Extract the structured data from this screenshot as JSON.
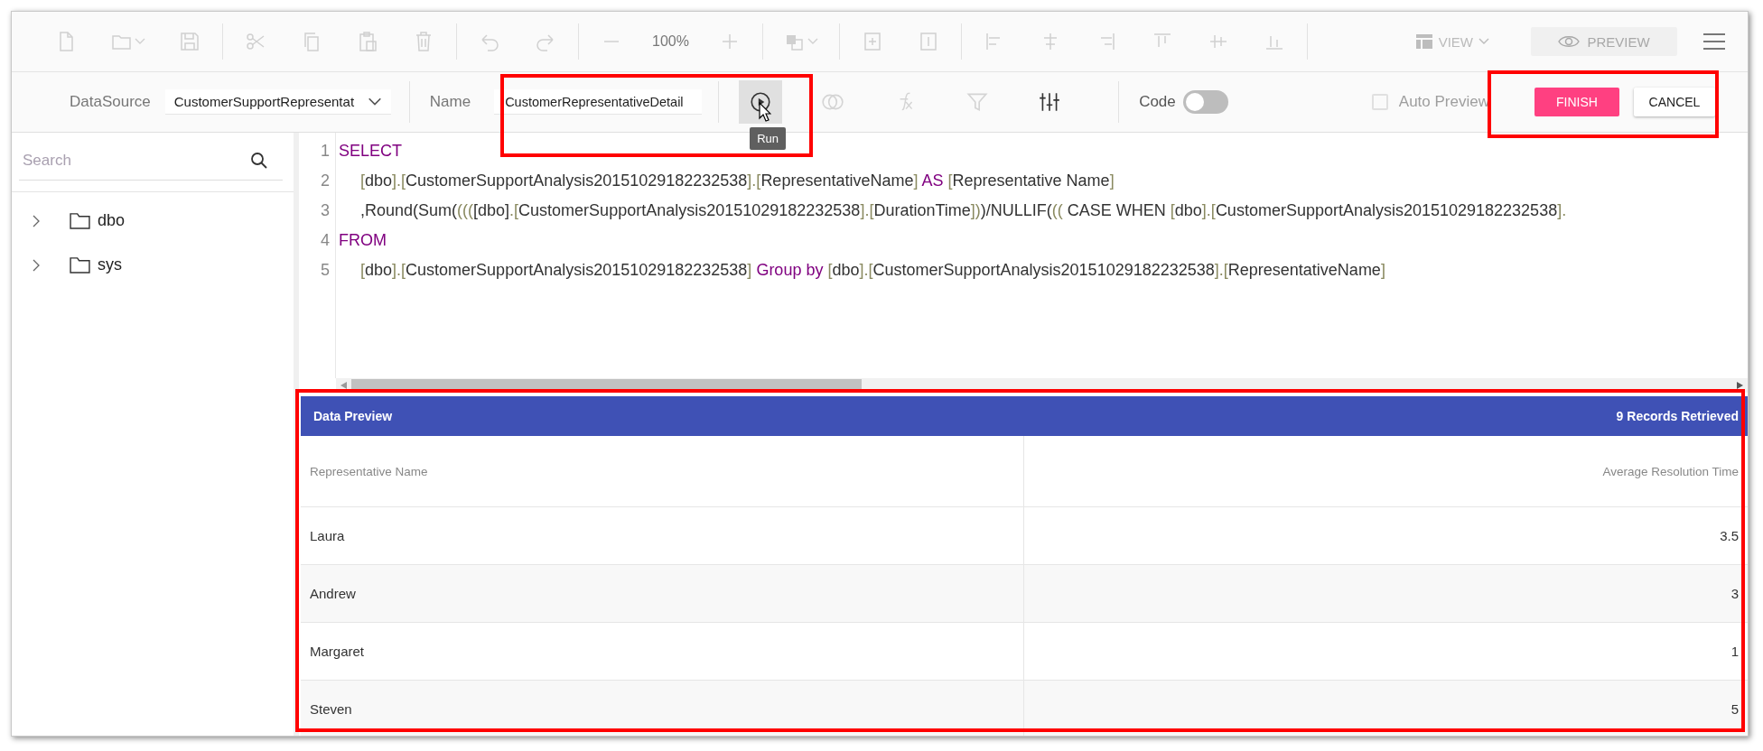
{
  "toolbar": {
    "items": [
      {
        "kind": "new",
        "disabled": true
      },
      {
        "kind": "open",
        "disabled": true
      },
      {
        "kind": "save",
        "disabled": true
      },
      {
        "kind": "separator"
      },
      {
        "kind": "cut",
        "disabled": true
      },
      {
        "kind": "copy",
        "disabled": true
      },
      {
        "kind": "paste",
        "disabled": true
      },
      {
        "kind": "delete",
        "disabled": true
      },
      {
        "kind": "separator"
      },
      {
        "kind": "undo",
        "disabled": true
      },
      {
        "kind": "redo",
        "disabled": true
      },
      {
        "kind": "separator"
      },
      {
        "kind": "zoom-out",
        "disabled": true
      },
      {
        "kind": "zoom-level",
        "text": "100%",
        "disabled": true
      },
      {
        "kind": "zoom-in",
        "disabled": true
      },
      {
        "kind": "separator"
      },
      {
        "kind": "layer",
        "disabled": true
      },
      {
        "kind": "separator"
      },
      {
        "kind": "fit-height",
        "disabled": true
      },
      {
        "kind": "fit-width",
        "disabled": true
      },
      {
        "kind": "separator"
      },
      {
        "kind": "align-left",
        "disabled": true
      },
      {
        "kind": "align-center",
        "disabled": true
      },
      {
        "kind": "align-right",
        "disabled": true
      },
      {
        "kind": "align-top",
        "disabled": true
      },
      {
        "kind": "align-middle",
        "disabled": true
      },
      {
        "kind": "align-bottom",
        "disabled": true
      },
      {
        "kind": "separator"
      }
    ],
    "view_label": "VIEW",
    "preview_label": "PREVIEW",
    "preview_disabled": true
  },
  "query_bar": {
    "datasource_label": "DataSource",
    "datasource_value": "CustomerSupportRepresentat",
    "name_label": "Name",
    "name_value": "CustomerRepresentativeDetail",
    "tools": [
      {
        "kind": "run",
        "active": true,
        "disabled": false,
        "tooltip": "Run"
      },
      {
        "kind": "join",
        "active": false,
        "disabled": true
      },
      {
        "kind": "formula",
        "active": false,
        "disabled": true
      },
      {
        "kind": "filter",
        "active": false,
        "disabled": true
      },
      {
        "kind": "sliders",
        "active": false,
        "disabled": false
      }
    ],
    "code_label": "Code",
    "code_on": false,
    "auto_preview_label": "Auto Preview",
    "auto_preview_checked": false,
    "auto_preview_disabled": true,
    "finish_label": "FINISH",
    "cancel_label": "CANCEL"
  },
  "sidebar": {
    "search_placeholder": "Search",
    "items": [
      {
        "label": "dbo",
        "expanded": false
      },
      {
        "label": "sys",
        "expanded": false
      }
    ]
  },
  "editor": {
    "lines": [
      {
        "number": "1",
        "indent": false,
        "tokens": [
          {
            "kind": "keyword",
            "text": "SELECT"
          }
        ]
      },
      {
        "number": "2",
        "indent": true,
        "tokens": [
          {
            "kind": "punct",
            "text": "["
          },
          {
            "kind": "text",
            "text": "dbo"
          },
          {
            "kind": "punct",
            "text": "].["
          },
          {
            "kind": "text",
            "text": "CustomerSupportAnalysis20151029182232538"
          },
          {
            "kind": "punct",
            "text": "].["
          },
          {
            "kind": "text",
            "text": "RepresentativeName"
          },
          {
            "kind": "punct",
            "text": "]"
          },
          {
            "kind": "keyword",
            "text": " AS "
          },
          {
            "kind": "punct",
            "text": "["
          },
          {
            "kind": "text",
            "text": "Representative Name"
          },
          {
            "kind": "punct",
            "text": "]"
          }
        ]
      },
      {
        "number": "3",
        "indent": true,
        "tokens": [
          {
            "kind": "text",
            "text": ",Round(Sum("
          },
          {
            "kind": "punct",
            "text": "((("
          },
          {
            "kind": "text",
            "text": "[dbo]"
          },
          {
            "kind": "punct",
            "text": ".["
          },
          {
            "kind": "text",
            "text": "CustomerSupportAnalysis20151029182232538"
          },
          {
            "kind": "punct",
            "text": "].["
          },
          {
            "kind": "text",
            "text": "DurationTime"
          },
          {
            "kind": "punct",
            "text": "])"
          },
          {
            "kind": "text",
            "text": ")/NULLIF("
          },
          {
            "kind": "punct",
            "text": "(("
          },
          {
            "kind": "text",
            "text": " CASE WHEN "
          },
          {
            "kind": "punct",
            "text": "["
          },
          {
            "kind": "text",
            "text": "dbo"
          },
          {
            "kind": "punct",
            "text": "].["
          },
          {
            "kind": "text",
            "text": "CustomerSupportAnalysis20151029182232538"
          },
          {
            "kind": "punct",
            "text": "]."
          }
        ]
      },
      {
        "number": "4",
        "indent": false,
        "tokens": [
          {
            "kind": "keyword",
            "text": "FROM"
          }
        ]
      },
      {
        "number": "5",
        "indent": true,
        "tokens": [
          {
            "kind": "punct",
            "text": "["
          },
          {
            "kind": "text",
            "text": "dbo"
          },
          {
            "kind": "punct",
            "text": "].["
          },
          {
            "kind": "text",
            "text": "CustomerSupportAnalysis20151029182232538"
          },
          {
            "kind": "punct",
            "text": "]"
          },
          {
            "kind": "keyword",
            "text": " Group by "
          },
          {
            "kind": "punct",
            "text": "["
          },
          {
            "kind": "text",
            "text": "dbo"
          },
          {
            "kind": "punct",
            "text": "].["
          },
          {
            "kind": "text",
            "text": "CustomerSupportAnalysis20151029182232538"
          },
          {
            "kind": "punct",
            "text": "].["
          },
          {
            "kind": "text",
            "text": "RepresentativeName"
          },
          {
            "kind": "punct",
            "text": "]"
          }
        ]
      }
    ]
  },
  "preview": {
    "title": "Data Preview",
    "count": "9 Records Retrieved",
    "columns": [
      "Representative Name",
      "Average Resolution Time"
    ],
    "rows": [
      [
        "Laura",
        "3.5"
      ],
      [
        "Andrew",
        "3"
      ],
      [
        "Margaret",
        "1"
      ],
      [
        "Steven",
        "5"
      ]
    ]
  }
}
